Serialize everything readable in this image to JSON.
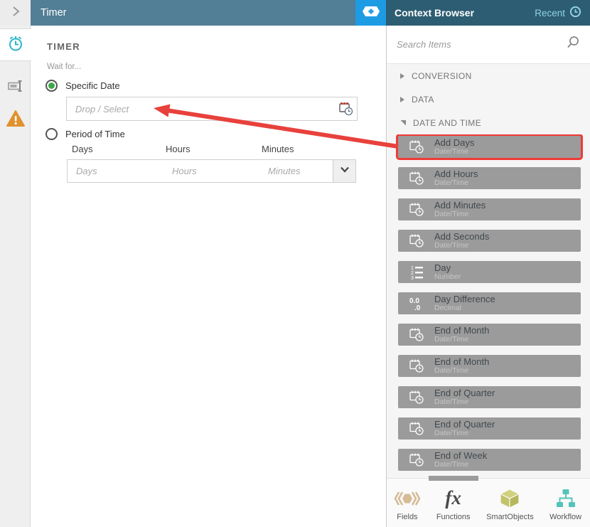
{
  "header": {
    "collapse_icon": "chevron-right-icon",
    "title": "Timer",
    "add_badge_icon": "tag-plus-icon",
    "context_title": "Context Browser",
    "recent_label": "Recent",
    "recent_icon": "clock-icon"
  },
  "sidebar": {
    "icons": [
      {
        "name": "timer-icon",
        "active": true
      },
      {
        "name": "rename-icon",
        "active": false
      },
      {
        "name": "warning-icon",
        "active": false
      }
    ]
  },
  "timer_panel": {
    "heading": "TIMER",
    "wait_label": "Wait for...",
    "options": [
      {
        "label": "Specific Date",
        "selected": true
      },
      {
        "label": "Period of Time",
        "selected": false
      }
    ],
    "date_input": {
      "placeholder": "Drop / Select",
      "icon": "calendar-clock-icon"
    },
    "period_fields": [
      {
        "label": "Days",
        "placeholder": "Days"
      },
      {
        "label": "Hours",
        "placeholder": "Hours"
      },
      {
        "label": "Minutes",
        "placeholder": "Minutes",
        "has_dropdown": true
      }
    ]
  },
  "context": {
    "search_placeholder": "Search Items",
    "search_icon": "search-icon",
    "sections": [
      {
        "label": "CONVERSION",
        "expanded": false
      },
      {
        "label": "DATA",
        "expanded": false
      },
      {
        "label": "DATE AND TIME",
        "expanded": true
      }
    ],
    "items": [
      {
        "title": "Add Days",
        "subtitle": "Date/Time",
        "icon": "calendar-clock",
        "highlighted": true
      },
      {
        "title": "Add Hours",
        "subtitle": "Date/Time",
        "icon": "calendar-clock",
        "highlighted": false
      },
      {
        "title": "Add Minutes",
        "subtitle": "Date/Time",
        "icon": "calendar-clock",
        "highlighted": false
      },
      {
        "title": "Add Seconds",
        "subtitle": "Date/Time",
        "icon": "calendar-clock",
        "highlighted": false
      },
      {
        "title": "Day",
        "subtitle": "Number",
        "icon": "numbered-list",
        "highlighted": false
      },
      {
        "title": "Day Difference",
        "subtitle": "Decimal",
        "icon": "decimal",
        "highlighted": false
      },
      {
        "title": "End of Month",
        "subtitle": "Date/Time",
        "icon": "calendar-clock",
        "highlighted": false
      },
      {
        "title": "End of Month",
        "subtitle": "Date/Time",
        "icon": "calendar-clock",
        "highlighted": false
      },
      {
        "title": "End of Quarter",
        "subtitle": "Date/Time",
        "icon": "calendar-clock",
        "highlighted": false
      },
      {
        "title": "End of Quarter",
        "subtitle": "Date/Time",
        "icon": "calendar-clock",
        "highlighted": false
      },
      {
        "title": "End of Week",
        "subtitle": "Date/Time",
        "icon": "calendar-clock",
        "highlighted": false
      }
    ],
    "tabs": [
      {
        "label": "Fields",
        "icon": "fields-icon",
        "active": false
      },
      {
        "label": "Functions",
        "icon": "functions-icon",
        "active": true
      },
      {
        "label": "SmartObjects",
        "icon": "smartobjects-icon",
        "active": false
      },
      {
        "label": "Workflow",
        "icon": "workflow-icon",
        "active": false
      }
    ]
  },
  "colors": {
    "timer_header": "#527e96",
    "context_header": "#2d5d72",
    "add_badge": "#1d9ce4",
    "recent_text": "#8fd2e8",
    "item_gray": "#9b9b9b",
    "highlight_red": "#ee3b36",
    "arrow_red": "#e8413c",
    "radio_green": "#3da848",
    "warning_orange": "#e0922f",
    "timer_icon_teal": "#2ab6c9",
    "fields_tan": "#d6bb96",
    "smartobjects_olive": "#c2c36a",
    "workflow_teal": "#52c4b8"
  }
}
